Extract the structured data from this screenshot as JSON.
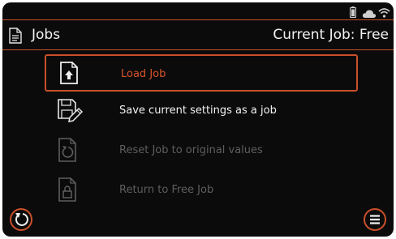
{
  "status_bar": {
    "icons": [
      "battery-icon",
      "cloud-icon",
      "wifi-icon"
    ]
  },
  "header": {
    "title": "Jobs",
    "current_job": "Current Job: Free"
  },
  "menu": {
    "items": [
      {
        "label": "Load Job",
        "icon": "load-job-icon",
        "state": "selected"
      },
      {
        "label": "Save current settings as a job",
        "icon": "save-job-icon",
        "state": "enabled"
      },
      {
        "label": "Reset Job to original values",
        "icon": "reset-job-icon",
        "state": "disabled"
      },
      {
        "label": "Return to Free Job",
        "icon": "return-free-job-icon",
        "state": "disabled"
      }
    ]
  },
  "footer": {
    "left_button_icon": "back-icon",
    "right_button_icon": "menu-icon"
  },
  "colors": {
    "accent": "#c9502a",
    "selected_text": "#d9542c",
    "text": "#f2f2f2",
    "disabled": "#5e5e5e",
    "background": "#0b0b0b"
  }
}
